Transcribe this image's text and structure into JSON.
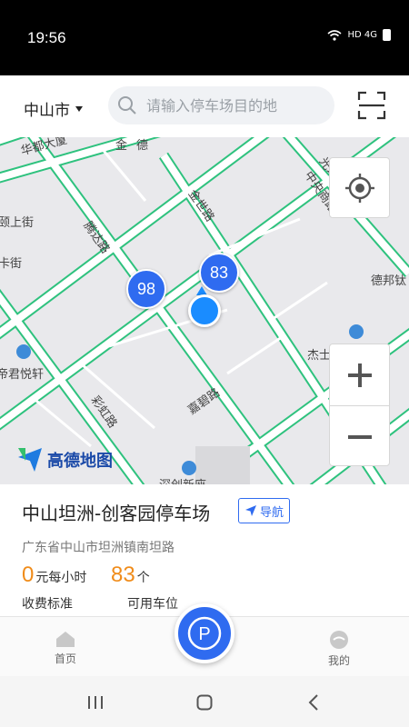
{
  "status_bar": {
    "time": "19:56",
    "network": "HD 4G"
  },
  "header": {
    "city": "中山市",
    "search_placeholder": "请输入停车场目的地"
  },
  "map": {
    "road_labels": [
      "华都大厦",
      "金",
      "德",
      "颐上街",
      "腾达路",
      "金世路",
      "中央商路",
      "德邦钛",
      "帝君悦轩",
      "杰士美生活小区",
      "彩虹路",
      "嘉碧路",
      "深创新座",
      "卡街",
      "光环"
    ],
    "markers": [
      {
        "count": "98"
      },
      {
        "count": "83"
      }
    ],
    "logo_text": "高德地图",
    "colors": {
      "road_border": "#2ec27e",
      "marker": "#2f6bf0",
      "user_dot": "#1a8cff"
    }
  },
  "parking": {
    "name": "中山坦洲-创客园停车场",
    "nav_label": "导航",
    "address": "广东省中山市坦洲镇南坦路",
    "fee_value": "0",
    "fee_unit": "元每小时",
    "fee_label": "收费标准",
    "spaces_value": "83",
    "spaces_unit": "个",
    "spaces_label": "可用车位"
  },
  "tabbar": {
    "home_label": "首页",
    "mine_label": "我的",
    "center_icon": "parking-p-icon"
  }
}
